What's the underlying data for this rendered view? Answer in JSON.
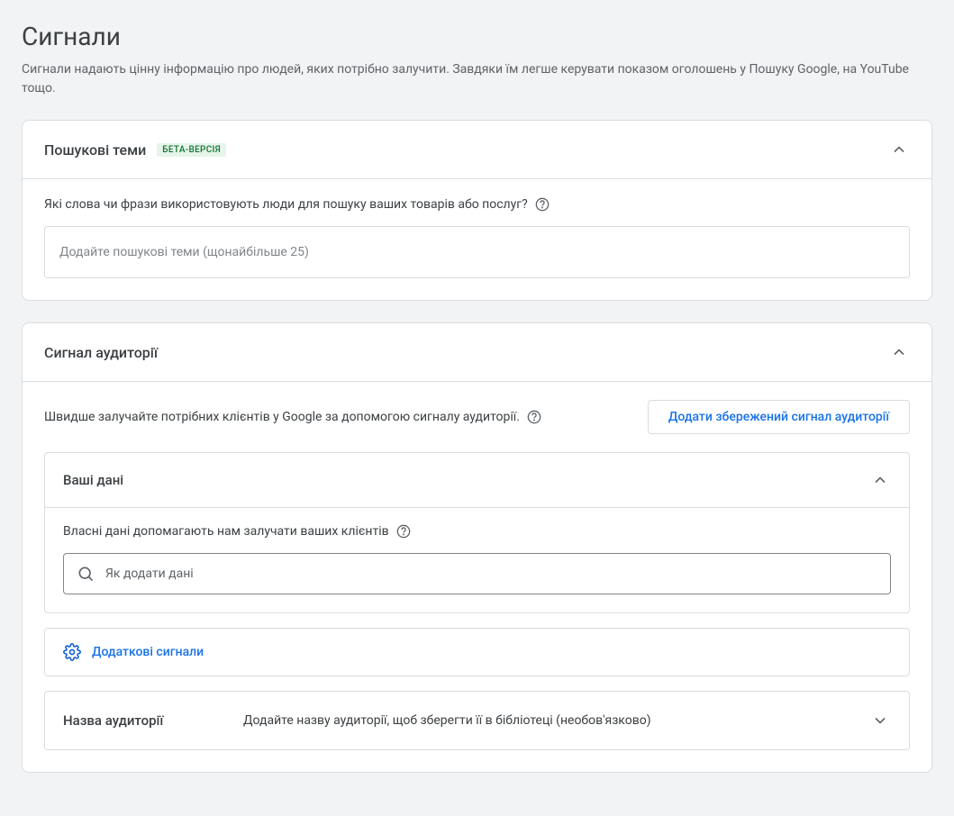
{
  "page": {
    "title": "Сигнали",
    "subtitle": "Сигнали надають цінну інформацію про людей, яких потрібно залучити. Завдяки їм легше керувати показом оголошень у Пошуку Google, на YouTube тощо."
  },
  "searchThemes": {
    "title": "Пошукові теми",
    "betaLabel": "БЕТА-ВЕРСІЯ",
    "question": "Які слова чи фрази використовують люди для пошуку ваших товарів або послуг?",
    "inputPlaceholder": "Додайте пошукові теми (щонайбільше 25)"
  },
  "audienceSignal": {
    "title": "Сигнал аудиторії",
    "description": "Швидше залучайте потрібних клієнтів у Google за допомогою сигналу аудиторії.",
    "addSavedButton": "Додати збережений сигнал аудиторії",
    "yourData": {
      "title": "Ваші дані",
      "description": "Власні дані допомагають нам залучати ваших клієнтів",
      "searchPlaceholder": "Як додати дані"
    },
    "additionalSignals": "Додаткові сигнали",
    "audienceName": {
      "label": "Назва аудиторії",
      "placeholder": "Додайте назву аудиторії, щоб зберегти її в бібліотеці (необов'язково)"
    }
  }
}
